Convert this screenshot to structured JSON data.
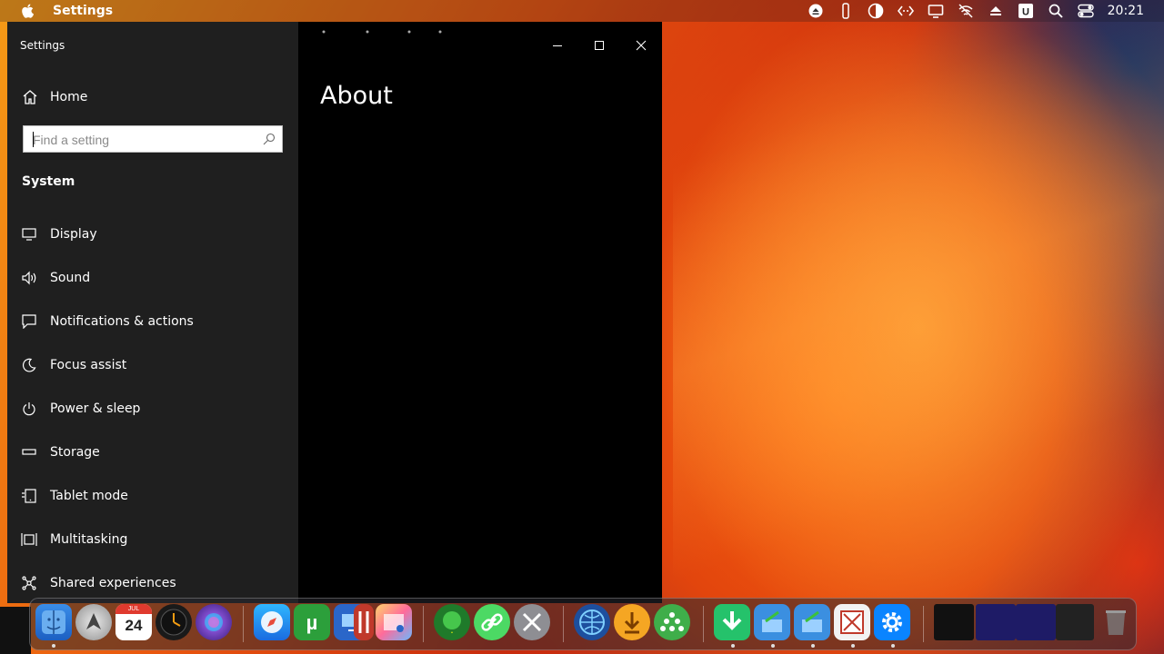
{
  "menubar": {
    "app_name": "Settings",
    "clock": "20:21"
  },
  "window": {
    "title": "Settings",
    "home_label": "Home",
    "search_placeholder": "Find a setting",
    "section_label": "System",
    "nav_items": [
      {
        "label": "Display",
        "icon": "monitor-icon"
      },
      {
        "label": "Sound",
        "icon": "speaker-icon"
      },
      {
        "label": "Notifications & actions",
        "icon": "notification-icon"
      },
      {
        "label": "Focus assist",
        "icon": "moon-icon"
      },
      {
        "label": "Power & sleep",
        "icon": "power-icon"
      },
      {
        "label": "Storage",
        "icon": "storage-icon"
      },
      {
        "label": "Tablet mode",
        "icon": "tablet-icon"
      },
      {
        "label": "Multitasking",
        "icon": "multitask-icon"
      },
      {
        "label": "Shared experiences",
        "icon": "share-icon"
      }
    ],
    "page_heading": "About"
  },
  "dock": {
    "calendar_day": "24",
    "calendar_month": "JUL"
  },
  "colors": {
    "sidebar_bg": "#1f1f1f",
    "content_bg": "#000000",
    "accent": "#0078d4"
  }
}
